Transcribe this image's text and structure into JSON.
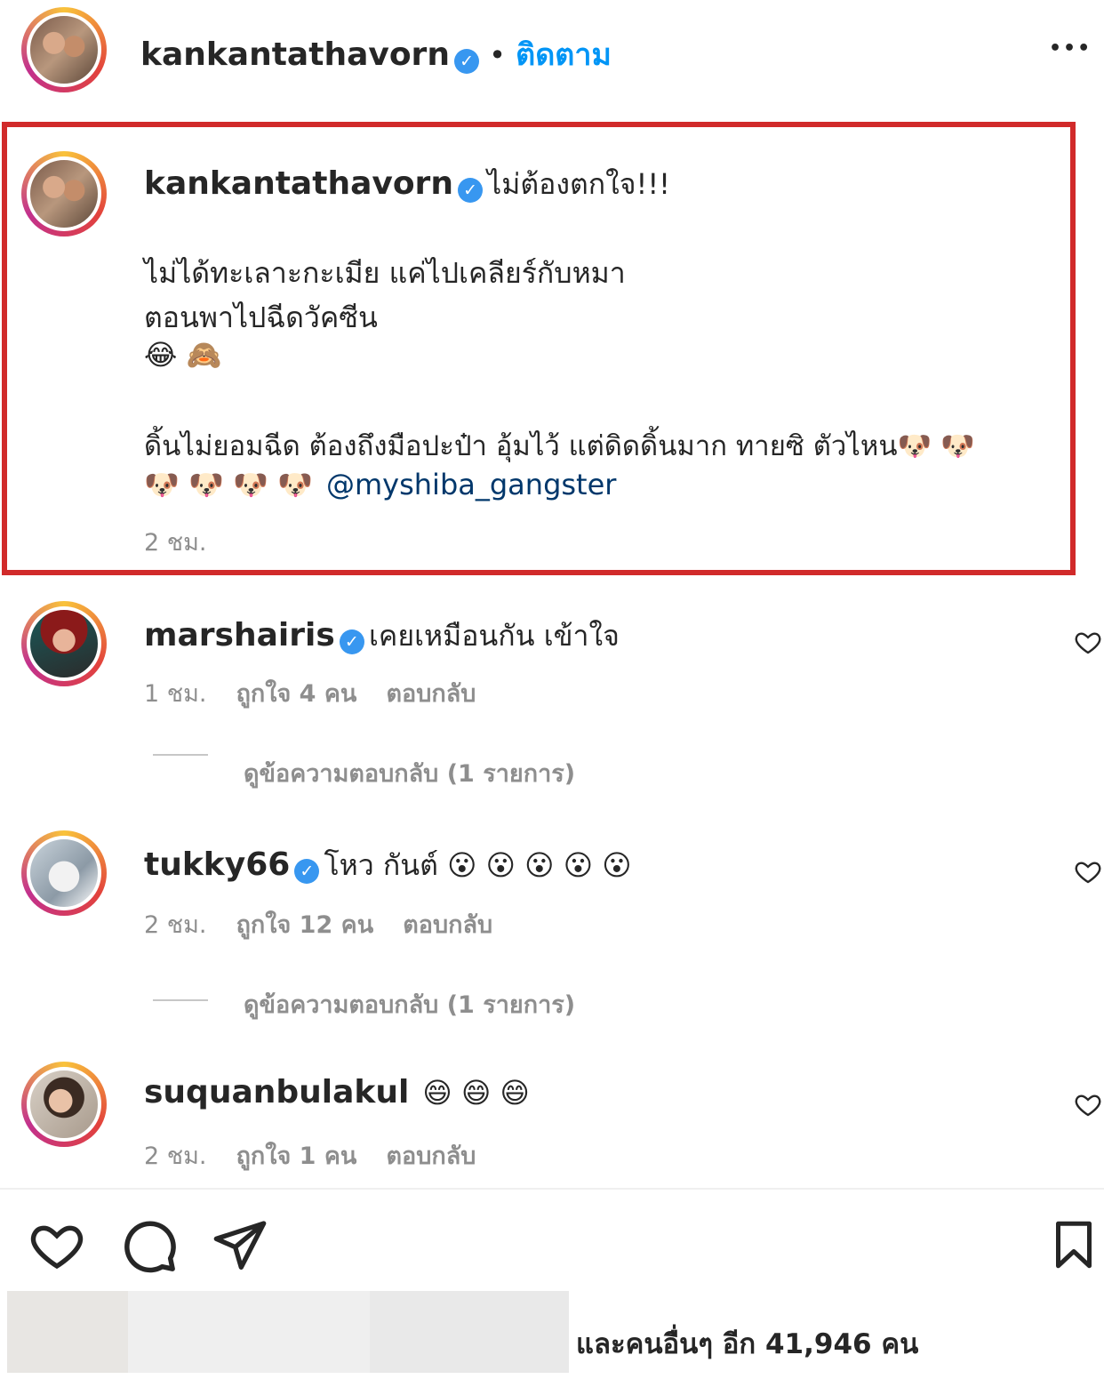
{
  "header": {
    "username": "kankantathavorn",
    "dot": "•",
    "follow_label": "ติดตาม",
    "more_label": "•••"
  },
  "caption": {
    "username": "kankantathavorn",
    "title": "ไม่ต้องตกใจ!!!",
    "line1": "ไม่ได้ทะเลาะกะเมีย แค่ไปเคลียร์กับหมา",
    "line2": "ตอนพาไปฉีดวัคซีน",
    "emoji_line": "😂 🙈",
    "line3": "ดิ้นไม่ยอมฉีด ต้องถึงมือปะป๋า อุ้มไว้ แต่ดิดดิ้นมาก ทายซิ ตัวไหน🐶 🐶",
    "line4_emoji": "🐶 🐶 🐶 🐶",
    "mention": "@myshiba_gangster",
    "time": "2 ชม."
  },
  "comments": [
    {
      "username": "marshairis",
      "verified": true,
      "text": "เคยเหมือนกัน เข้าใจ",
      "time": "1 ชม.",
      "likes": "ถูกใจ 4 คน",
      "reply": "ตอบกลับ",
      "view_replies": "ดูข้อความตอบกลับ (1 รายการ)"
    },
    {
      "username": "tukky66",
      "verified": true,
      "text": "โหว กันต์ 😮 😮 😮 😮 😮",
      "time": "2 ชม.",
      "likes": "ถูกใจ 12 คน",
      "reply": "ตอบกลับ",
      "view_replies": "ดูข้อความตอบกลับ (1 รายการ)"
    },
    {
      "username": "suquanbulakul",
      "verified": false,
      "text": "😄 😄 😄",
      "time": "2 ชม.",
      "likes": "ถูกใจ 1 คน",
      "reply": "ตอบกลับ"
    }
  ],
  "footer": {
    "likes_text": "และคนอื่นๆ อีก 41,946 คน"
  },
  "colors": {
    "verified": "#3897f0",
    "follow": "#0095f6",
    "highlight_border": "#d12a2a",
    "muted": "#8e8e8e"
  },
  "icons": [
    "heart-icon",
    "comment-icon",
    "share-icon",
    "bookmark-icon",
    "more-icon",
    "verified-badge-icon"
  ]
}
